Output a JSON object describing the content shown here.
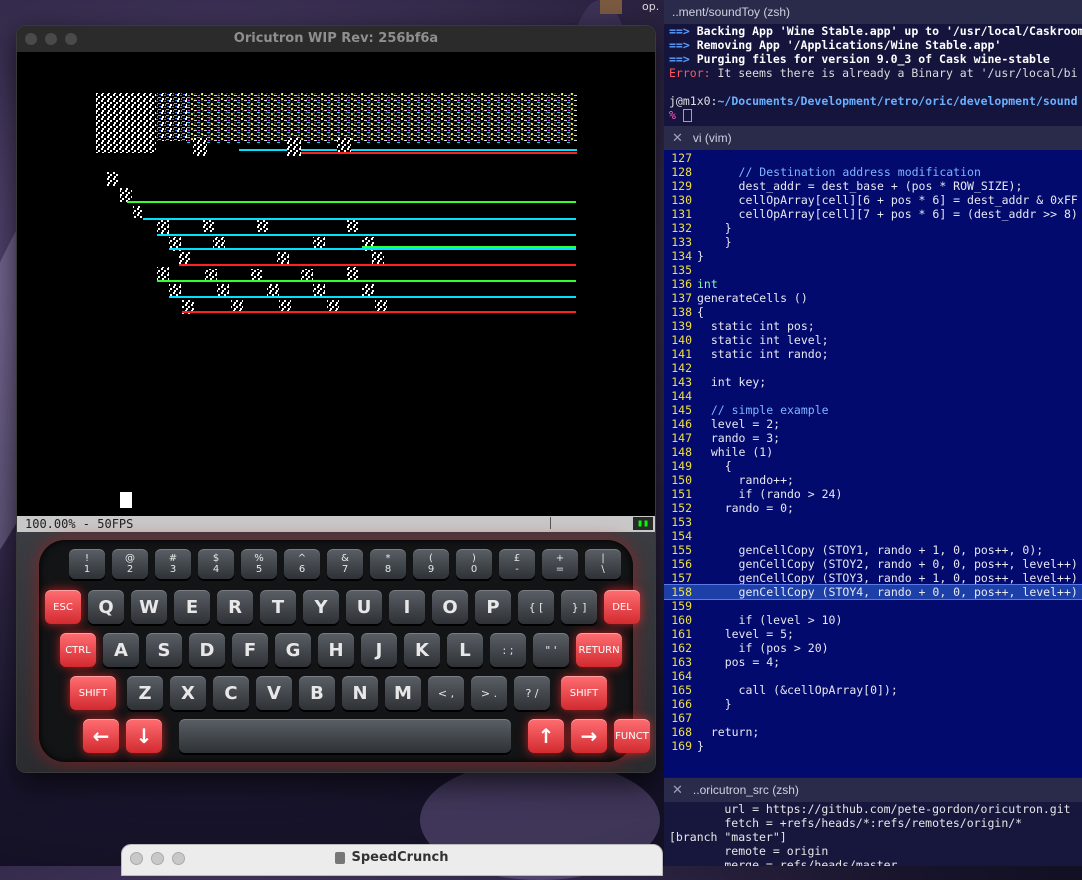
{
  "oric": {
    "title": "Oricutron WIP Rev: 256bf6a",
    "status_text": "100.00% -   50FPS",
    "keyboard_rows": [
      [
        {
          "top": "!",
          "bot": "1"
        },
        {
          "top": "@",
          "bot": "2"
        },
        {
          "top": "#",
          "bot": "3"
        },
        {
          "top": "$",
          "bot": "4"
        },
        {
          "top": "%",
          "bot": "5"
        },
        {
          "top": "^",
          "bot": "6"
        },
        {
          "top": "&",
          "bot": "7"
        },
        {
          "top": "*",
          "bot": "8"
        },
        {
          "top": "(",
          "bot": "9"
        },
        {
          "top": ")",
          "bot": "0"
        },
        {
          "top": "£",
          "bot": "-"
        },
        {
          "top": "+",
          "bot": "="
        },
        {
          "top": "|",
          "bot": "\\"
        }
      ],
      [
        "ESC",
        "Q",
        "W",
        "E",
        "R",
        "T",
        "Y",
        "U",
        "I",
        "O",
        "P",
        "{ [",
        "} ]",
        "DEL"
      ],
      [
        "CTRL",
        "A",
        "S",
        "D",
        "F",
        "G",
        "H",
        "J",
        "K",
        "L",
        ": ;",
        "\" '",
        "RETURN"
      ],
      [
        "SHIFT",
        "Z",
        "X",
        "C",
        "V",
        "B",
        "N",
        "M",
        "< ,",
        "> .",
        "? /",
        "SHIFT"
      ],
      [
        "←",
        "↓",
        "",
        "↑",
        "→",
        "FUNCT"
      ]
    ]
  },
  "terminal": {
    "top_pane_title": "..ment/soundToy (zsh)",
    "top_lines": [
      {
        "pre": "==> ",
        "text": "Backing App 'Wine Stable.app' up to '/usr/local/Caskroom"
      },
      {
        "pre": "==> ",
        "text": "Removing App '/Applications/Wine Stable.app'"
      },
      {
        "pre": "==> ",
        "text": "Purging files for version 9.0_3 of Cask wine-stable"
      }
    ],
    "error_label": "Error:",
    "error_text": " It seems there is already a Binary at '/usr/local/bi",
    "prompt_host": "j@m1x0:",
    "prompt_path": "~/Documents/Development/retro/oric/development/sound",
    "prompt_symbol": "% ",
    "vim_title": "vi (vim)",
    "shell_title": "..oricutron_src (zsh)",
    "shell_lines": [
      "        url = https://github.com/pete-gordon/oricutron.git",
      "        fetch = +refs/heads/*:refs/remotes/origin/*",
      "[branch \"master\"]",
      "        remote = origin",
      "        merge = refs/heads/master"
    ]
  },
  "vim_code": [
    {
      "n": "127",
      "t": ""
    },
    {
      "n": "128",
      "t": "      // Destination address modification",
      "cls": "cm"
    },
    {
      "n": "129",
      "t": "      dest_addr = dest_base + (pos * ROW_SIZE);"
    },
    {
      "n": "130",
      "t": "      cellOpArray[cell][6 + pos * 6] = dest_addr & 0xFF"
    },
    {
      "n": "131",
      "t": "      cellOpArray[cell][7 + pos * 6] = (dest_addr >> 8)"
    },
    {
      "n": "132",
      "t": "    }"
    },
    {
      "n": "133",
      "t": "    }"
    },
    {
      "n": "134",
      "t": "}"
    },
    {
      "n": "135",
      "t": ""
    },
    {
      "n": "136",
      "t": "int",
      "cls": "kw"
    },
    {
      "n": "137",
      "t": "generateCells ()"
    },
    {
      "n": "138",
      "t": "{"
    },
    {
      "n": "139",
      "t": "  static int pos;"
    },
    {
      "n": "140",
      "t": "  static int level;"
    },
    {
      "n": "141",
      "t": "  static int rando;"
    },
    {
      "n": "142",
      "t": ""
    },
    {
      "n": "143",
      "t": "  int key;"
    },
    {
      "n": "144",
      "t": ""
    },
    {
      "n": "145",
      "t": "  // simple example",
      "cls": "cm"
    },
    {
      "n": "146",
      "t": "  level = 2;"
    },
    {
      "n": "147",
      "t": "  rando = 3;"
    },
    {
      "n": "148",
      "t": "  while (1)"
    },
    {
      "n": "149",
      "t": "    {"
    },
    {
      "n": "150",
      "t": "      rando++;"
    },
    {
      "n": "151",
      "t": "      if (rando > 24)"
    },
    {
      "n": "152",
      "t": "    rando = 0;"
    },
    {
      "n": "153",
      "t": ""
    },
    {
      "n": "154",
      "t": ""
    },
    {
      "n": "155",
      "t": "      genCellCopy (STOY1, rando + 1, 0, pos++, 0);"
    },
    {
      "n": "156",
      "t": "      genCellCopy (STOY2, rando + 0, 0, pos++, level++)"
    },
    {
      "n": "157",
      "t": "      genCellCopy (STOY3, rando + 1, 0, pos++, level++)"
    },
    {
      "n": "158",
      "t": "      genCellCopy (STOY4, rando + 0, 0, pos++, level++)",
      "cur": true
    },
    {
      "n": "159",
      "t": ""
    },
    {
      "n": "160",
      "t": "      if (level > 10)"
    },
    {
      "n": "161",
      "t": "    level = 5;"
    },
    {
      "n": "162",
      "t": "      if (pos > 20)"
    },
    {
      "n": "163",
      "t": "    pos = 4;"
    },
    {
      "n": "164",
      "t": ""
    },
    {
      "n": "165",
      "t": "      call (&cellOpArray[0]);"
    },
    {
      "n": "166",
      "t": "    }"
    },
    {
      "n": "167",
      "t": ""
    },
    {
      "n": "168",
      "t": "  return;"
    },
    {
      "n": "169",
      "t": "}"
    }
  ],
  "speedcrunch": {
    "title": "SpeedCrunch"
  },
  "top_strip": {
    "label": "op."
  }
}
